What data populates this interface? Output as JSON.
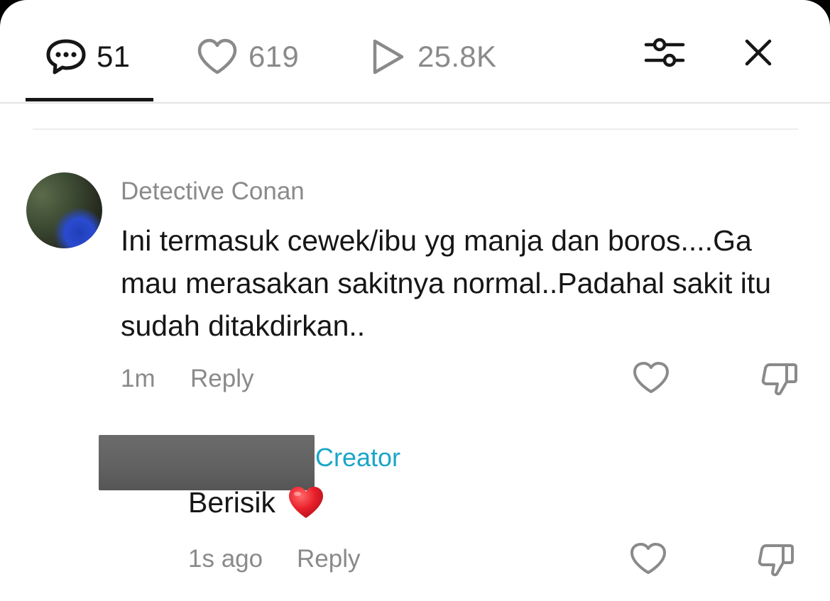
{
  "tabs": {
    "comments": {
      "icon": "comment-bubble-icon",
      "count": "51"
    },
    "likes": {
      "icon": "heart-icon",
      "count": "619"
    },
    "views": {
      "icon": "play-icon",
      "count": "25.8K"
    }
  },
  "actions": {
    "filter_icon": "sliders-icon",
    "close_icon": "close-icon"
  },
  "comment": {
    "author": "Detective Conan",
    "text": "Ini termasuk cewek/ibu yg manja dan boros....Ga mau merasakan sakitnya normal..Padahal sakit itu sudah ditakdirkan..",
    "time": "1m",
    "reply_label": "Reply"
  },
  "reply": {
    "badge": "Creator",
    "text": "Berisik",
    "emoji": "red-heart",
    "time": "1s ago",
    "reply_label": "Reply"
  },
  "colors": {
    "text": "#161616",
    "muted": "#8a8a8a",
    "creator": "#1aa6c8",
    "heart": "#e8202a"
  }
}
